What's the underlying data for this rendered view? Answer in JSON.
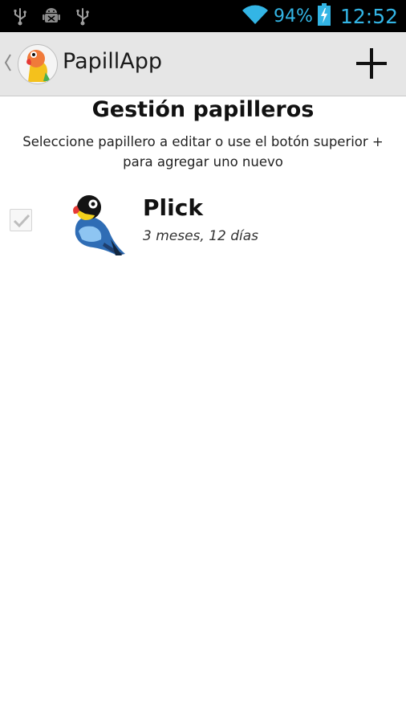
{
  "status_bar": {
    "battery_percent": "94%",
    "time": "12:52",
    "accent_color": "#33b5e5",
    "icons": [
      "usb-icon",
      "android-debug-icon",
      "usb-icon",
      "wifi-icon",
      "battery-charging-icon"
    ]
  },
  "action_bar": {
    "title": "PapillApp",
    "app_icon": "bird-logo-icon",
    "add_icon": "plus-icon"
  },
  "main": {
    "heading": "Gestión papilleros",
    "instructions_line1": "Seleccione papillero a editar o use el botón superior +",
    "instructions_line2": "para agregar uno nuevo",
    "items": [
      {
        "name": "Plick",
        "age": "3 meses, 12 días",
        "checked": true,
        "avatar_icon": "blue-bird-icon"
      }
    ]
  }
}
